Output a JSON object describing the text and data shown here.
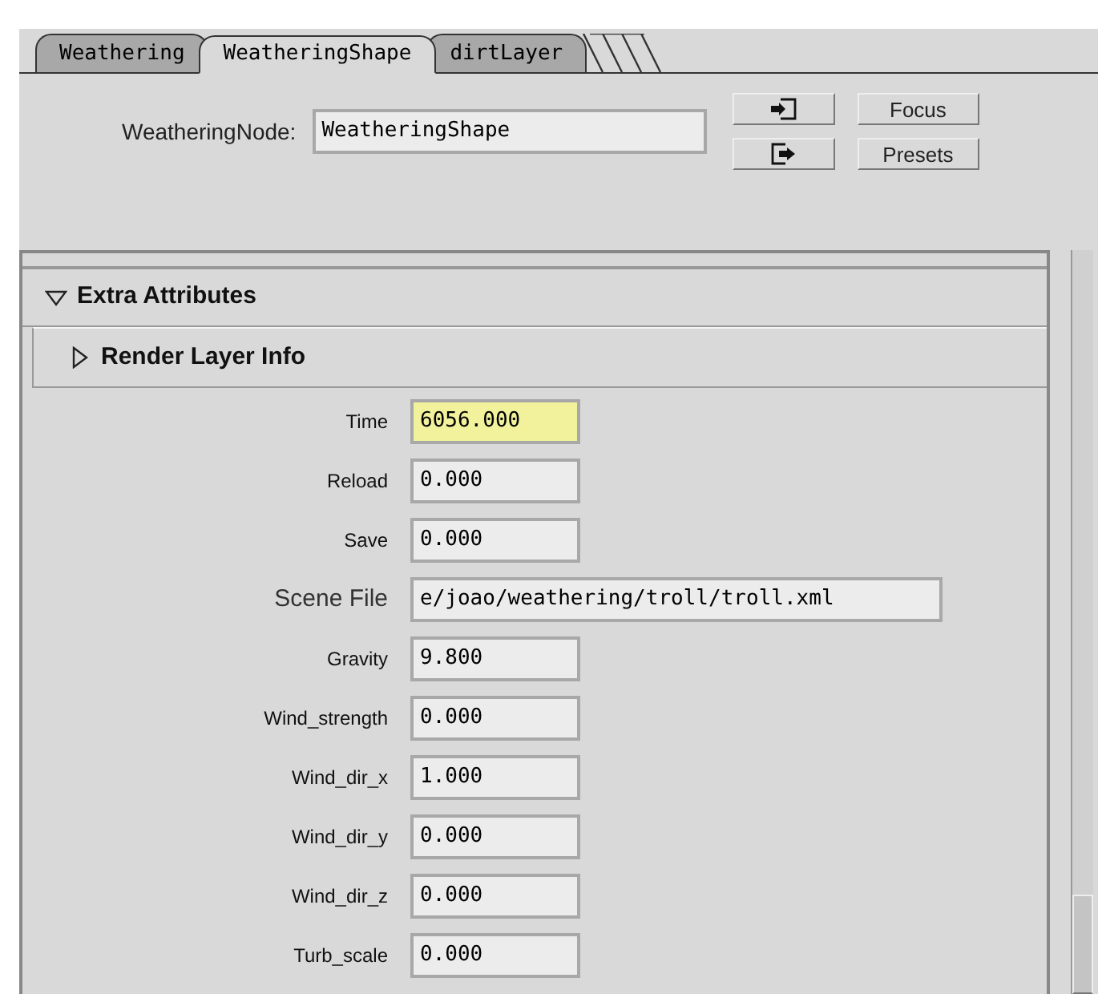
{
  "tabs": [
    {
      "label": "Weathering",
      "selected": false
    },
    {
      "label": "WeatheringShape",
      "selected": true
    },
    {
      "label": "dirtLayer",
      "selected": false
    }
  ],
  "node": {
    "label": "WeatheringNode:",
    "value": "WeatheringShape"
  },
  "buttons": [
    "Focus",
    "Presets"
  ],
  "section": {
    "title": "Extra Attributes",
    "expanded": true,
    "children": [
      {
        "title": "Render Layer Info",
        "expanded": false
      }
    ],
    "attributes": [
      {
        "label": "Time",
        "value": "6056.000",
        "kind": "float",
        "keyed": true
      },
      {
        "label": "Reload",
        "value": "0.000",
        "kind": "float",
        "keyed": false
      },
      {
        "label": "Save",
        "value": "0.000",
        "kind": "float",
        "keyed": false
      },
      {
        "label": "Scene File",
        "value": "e/joao/weathering/troll/troll.xml",
        "kind": "string",
        "keyed": false
      },
      {
        "label": "Gravity",
        "value": "9.800",
        "kind": "float",
        "keyed": false
      },
      {
        "label": "Wind_strength",
        "value": "0.000",
        "kind": "float",
        "keyed": false
      },
      {
        "label": "Wind_dir_x",
        "value": "1.000",
        "kind": "float",
        "keyed": false
      },
      {
        "label": "Wind_dir_y",
        "value": "0.000",
        "kind": "float",
        "keyed": false
      },
      {
        "label": "Wind_dir_z",
        "value": "0.000",
        "kind": "float",
        "keyed": false
      },
      {
        "label": "Turb_scale",
        "value": "0.000",
        "kind": "float",
        "keyed": false
      }
    ]
  }
}
